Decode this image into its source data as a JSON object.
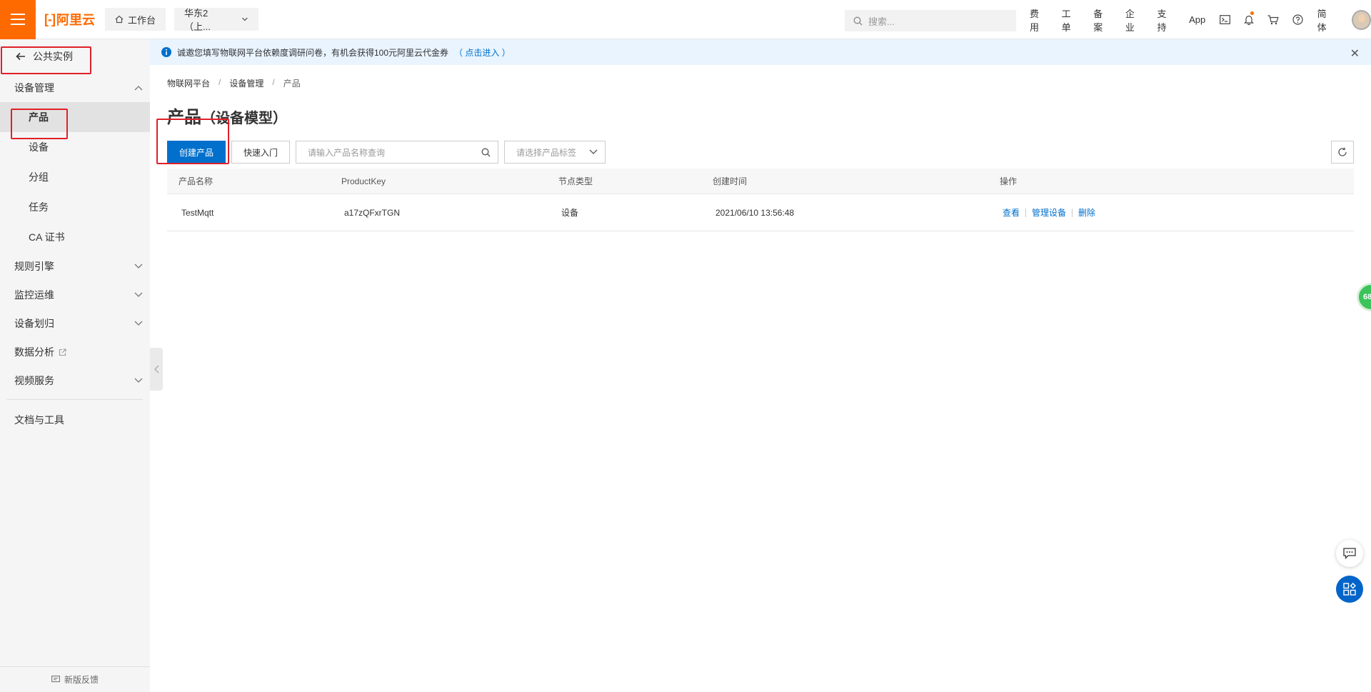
{
  "topbar": {
    "logo_text": "阿里云",
    "logo_bracket": "[-]",
    "workbench_label": "工作台",
    "region_label": "华东2（上...",
    "search_placeholder": "搜索...",
    "links": [
      "费用",
      "工单",
      "备案",
      "企业",
      "支持",
      "App"
    ],
    "lang_label": "简体",
    "accent_color": "#ff6a00"
  },
  "sidebar": {
    "back_label": "公共实例",
    "groups": [
      {
        "label": "设备管理",
        "expanded": true,
        "items": [
          "产品",
          "设备",
          "分组",
          "任务",
          "CA 证书"
        ]
      },
      {
        "label": "规则引擎",
        "expanded": false
      },
      {
        "label": "监控运维",
        "expanded": false
      },
      {
        "label": "设备划归",
        "expanded": false
      },
      {
        "label": "数据分析",
        "external": true
      },
      {
        "label": "视频服务",
        "expanded": false
      }
    ],
    "docs_label": "文档与工具",
    "feedback_label": "新版反馈",
    "active_item": "产品"
  },
  "notice": {
    "text": "诚邀您填写物联网平台依赖度调研问卷，有机会获得100元阿里云代金券",
    "link": "（ 点击进入 ）"
  },
  "breadcrumb": [
    "物联网平台",
    "设备管理",
    "产品"
  ],
  "page": {
    "title": "产品",
    "subtitle": "（设备模型）"
  },
  "toolbar": {
    "create_label": "创建产品",
    "quickstart_label": "快速入门",
    "search_placeholder": "请输入产品名称查询",
    "tag_placeholder": "请选择产品标签"
  },
  "table": {
    "headers": [
      "产品名称",
      "ProductKey",
      "节点类型",
      "创建时间",
      "操作"
    ],
    "rows": [
      {
        "name": "TestMqtt",
        "product_key": "a17zQFxrTGN",
        "node_type": "设备",
        "created": "2021/06/10 13:56:48",
        "actions": [
          "查看",
          "管理设备",
          "删除"
        ]
      }
    ]
  },
  "floating": {
    "badge_text": "68"
  },
  "colors": {
    "primary": "#0070cc",
    "annotation": "#e0202a"
  }
}
